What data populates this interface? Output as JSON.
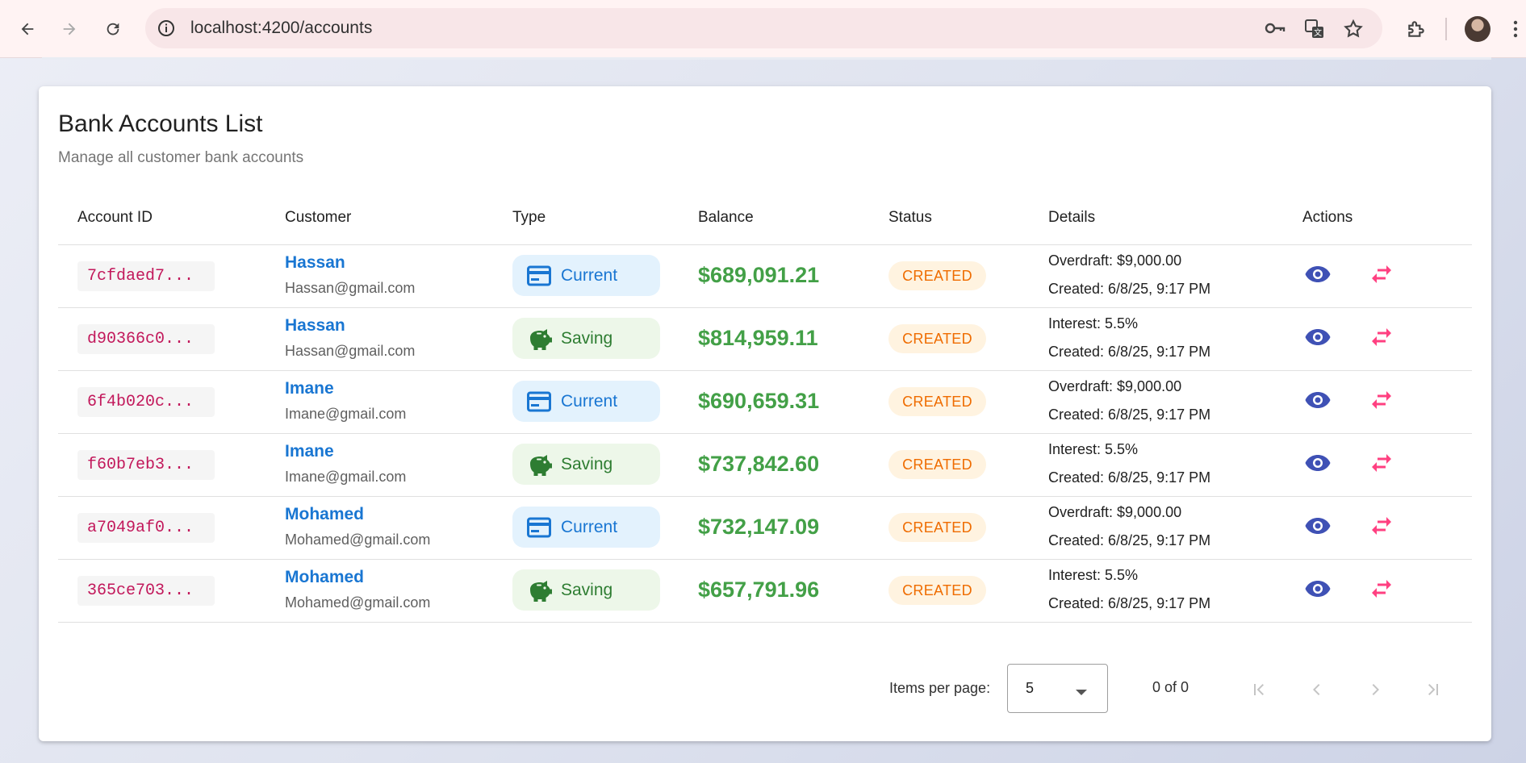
{
  "browser": {
    "url": "localhost:4200/accounts"
  },
  "page": {
    "title": "Bank Accounts List",
    "subtitle": "Manage all customer bank accounts"
  },
  "table": {
    "headers": {
      "account_id": "Account ID",
      "customer": "Customer",
      "type": "Type",
      "balance": "Balance",
      "status": "Status",
      "details": "Details",
      "actions": "Actions"
    },
    "rows": [
      {
        "id": "7cfdaed7...",
        "name": "Hassan",
        "email": "Hassan@gmail.com",
        "type": "Current",
        "type_icon": "credit-card-icon",
        "balance": "$689,091.21",
        "status": "CREATED",
        "detail1": "Overdraft: $9,000.00",
        "detail2": "Created: 6/8/25, 9:17 PM"
      },
      {
        "id": "d90366c0...",
        "name": "Hassan",
        "email": "Hassan@gmail.com",
        "type": "Saving",
        "type_icon": "piggy-bank-icon",
        "balance": "$814,959.11",
        "status": "CREATED",
        "detail1": "Interest: 5.5%",
        "detail2": "Created: 6/8/25, 9:17 PM"
      },
      {
        "id": "6f4b020c...",
        "name": "Imane",
        "email": "Imane@gmail.com",
        "type": "Current",
        "type_icon": "credit-card-icon",
        "balance": "$690,659.31",
        "status": "CREATED",
        "detail1": "Overdraft: $9,000.00",
        "detail2": "Created: 6/8/25, 9:17 PM"
      },
      {
        "id": "f60b7eb3...",
        "name": "Imane",
        "email": "Imane@gmail.com",
        "type": "Saving",
        "type_icon": "piggy-bank-icon",
        "balance": "$737,842.60",
        "status": "CREATED",
        "detail1": "Interest: 5.5%",
        "detail2": "Created: 6/8/25, 9:17 PM"
      },
      {
        "id": "a7049af0...",
        "name": "Mohamed",
        "email": "Mohamed@gmail.com",
        "type": "Current",
        "type_icon": "credit-card-icon",
        "balance": "$732,147.09",
        "status": "CREATED",
        "detail1": "Overdraft: $9,000.00",
        "detail2": "Created: 6/8/25, 9:17 PM"
      },
      {
        "id": "365ce703...",
        "name": "Mohamed",
        "email": "Mohamed@gmail.com",
        "type": "Saving",
        "type_icon": "piggy-bank-icon",
        "balance": "$657,791.96",
        "status": "CREATED",
        "detail1": "Interest: 5.5%",
        "detail2": "Created: 6/8/25, 9:17 PM"
      }
    ]
  },
  "paginator": {
    "items_per_page_label": "Items per page:",
    "items_per_page_value": "5",
    "range_label": "0 of 0"
  },
  "colors": {
    "primary_link": "#1976d2",
    "balance": "#43a047",
    "status_text": "#ef6c00",
    "status_bg": "#fff3e0",
    "view_icon": "#3f51b5",
    "transfer_icon": "#ff4081"
  }
}
